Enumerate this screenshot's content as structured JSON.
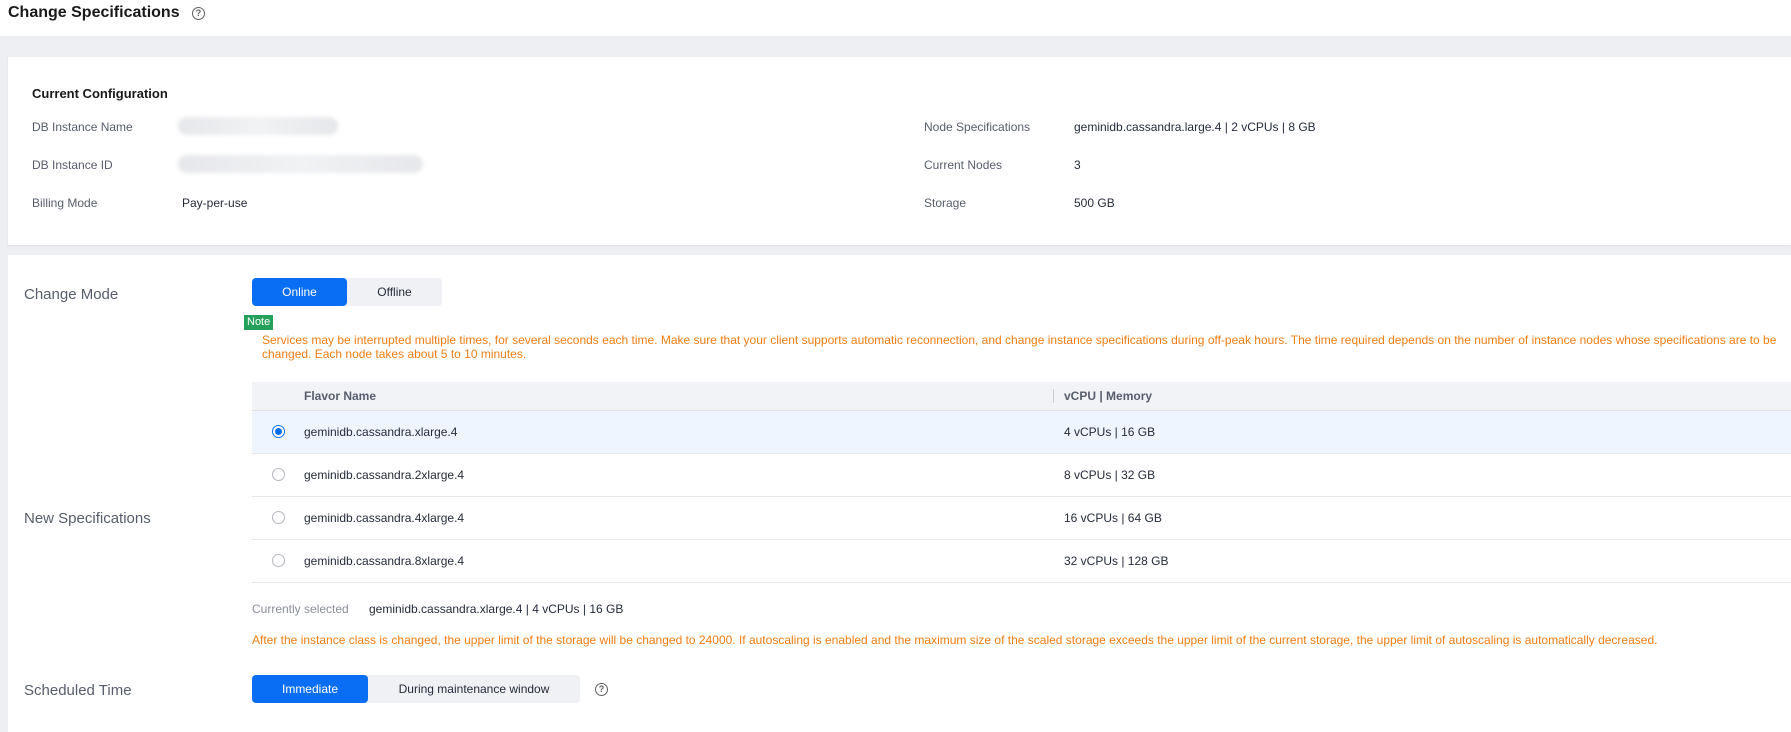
{
  "header": {
    "title": "Change Specifications",
    "help_icon": "question-circle-icon"
  },
  "current_config": {
    "title": "Current Configuration",
    "left": [
      {
        "label": "DB Instance Name",
        "value": ""
      },
      {
        "label": "DB Instance ID",
        "value": ""
      },
      {
        "label": "Billing Mode",
        "value": "Pay-per-use"
      }
    ],
    "right": [
      {
        "label": "Node Specifications",
        "value": "geminidb.cassandra.large.4 | 2 vCPUs | 8 GB"
      },
      {
        "label": "Current Nodes",
        "value": "3"
      },
      {
        "label": "Storage",
        "value": "500 GB"
      }
    ]
  },
  "change_mode": {
    "label": "Change Mode",
    "options": [
      "Online",
      "Offline"
    ],
    "selected": "Online"
  },
  "note": {
    "badge": "Note",
    "text": "Services may be interrupted multiple times, for several seconds each time. Make sure that your client supports automatic reconnection, and change instance specifications during off-peak hours. The time required depends on the number of instance nodes whose specifications are to be changed. Each node takes about 5 to 10 minutes."
  },
  "new_specs": {
    "label": "New Specifications",
    "columns": [
      "Flavor Name",
      "vCPU | Memory"
    ],
    "rows": [
      {
        "flavor": "geminidb.cassandra.xlarge.4",
        "vcpu_memory": "4 vCPUs | 16 GB",
        "selected": true
      },
      {
        "flavor": "geminidb.cassandra.2xlarge.4",
        "vcpu_memory": "8 vCPUs | 32 GB",
        "selected": false
      },
      {
        "flavor": "geminidb.cassandra.4xlarge.4",
        "vcpu_memory": "16 vCPUs | 64 GB",
        "selected": false
      },
      {
        "flavor": "geminidb.cassandra.8xlarge.4",
        "vcpu_memory": "32 vCPUs | 128 GB",
        "selected": false
      }
    ],
    "currently_selected_label": "Currently selected",
    "currently_selected_value": "geminidb.cassandra.xlarge.4 | 4 vCPUs | 16 GB",
    "warning": "After the instance class is changed, the upper limit of the storage will be changed to 24000. If autoscaling is enabled and the maximum size of the scaled storage exceeds the upper limit of the current storage, the upper limit of autoscaling is automatically decreased."
  },
  "scheduled_time": {
    "label": "Scheduled Time",
    "options": [
      "Immediate",
      "During maintenance window"
    ],
    "selected": "Immediate"
  },
  "colors": {
    "primary": "#0a6ef5",
    "warning": "#f07d14",
    "note_badge": "#23a15b"
  }
}
